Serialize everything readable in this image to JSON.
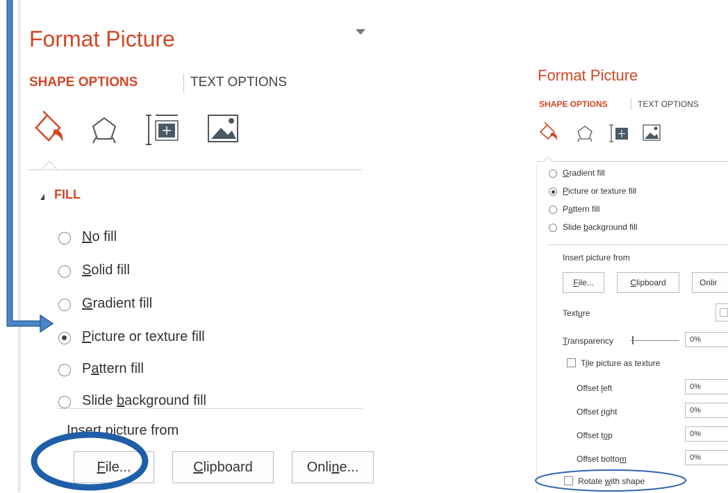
{
  "large_panel": {
    "title": "Format Picture",
    "tabs": [
      "SHAPE OPTIONS",
      "TEXT OPTIONS"
    ],
    "icons": [
      "fill-line-icon",
      "effects-pentagon-icon",
      "size-properties-icon",
      "picture-icon"
    ],
    "section": "FILL",
    "fill_options": [
      {
        "pre": "",
        "key": "N",
        "post": "o fill",
        "checked": false
      },
      {
        "pre": "",
        "key": "S",
        "post": "olid fill",
        "checked": false
      },
      {
        "pre": "",
        "key": "G",
        "post": "radient fill",
        "checked": false
      },
      {
        "pre": "",
        "key": "P",
        "post": "icture or texture fill",
        "checked": true
      },
      {
        "pre": "P",
        "key": "a",
        "post": "ttern fill",
        "checked": false
      },
      {
        "pre": "Slide ",
        "key": "b",
        "post": "ackground fill",
        "checked": false
      }
    ],
    "insert_label": "Insert picture from",
    "buttons": {
      "file": {
        "pre": "",
        "key": "F",
        "post": "ile..."
      },
      "clipboard": {
        "pre": "",
        "key": "C",
        "post": "lipboard"
      },
      "online": {
        "pre": "Onli",
        "key": "n",
        "post": "e..."
      }
    }
  },
  "small_panel": {
    "title": "Format Picture",
    "tabs": [
      "SHAPE OPTIONS",
      "TEXT OPTIONS"
    ],
    "fill_options": [
      {
        "pre": "",
        "key": "G",
        "post": "radient fill",
        "checked": false
      },
      {
        "pre": "",
        "key": "P",
        "post": "icture or texture fill",
        "checked": true
      },
      {
        "pre": "P",
        "key": "a",
        "post": "ttern fill",
        "checked": false
      },
      {
        "pre": "Slide ",
        "key": "b",
        "post": "ackground fill",
        "checked": false
      }
    ],
    "insert_label": "Insert picture from",
    "buttons": {
      "file": {
        "pre": "",
        "key": "F",
        "post": "ile..."
      },
      "clipboard": {
        "pre": "",
        "key": "C",
        "post": "lipboard"
      },
      "online": "Onlir"
    },
    "texture": {
      "pre": "Text",
      "key": "u",
      "post": "re"
    },
    "transparency": {
      "pre": "",
      "key": "T",
      "post": "ransparency",
      "value": "0%"
    },
    "tile_checkbox": {
      "pre": "T",
      "key": "i",
      "post": "le picture as texture"
    },
    "offsets": [
      {
        "pre": "Offset ",
        "key": "l",
        "post": "eft",
        "value": "0%"
      },
      {
        "pre": "Offset ",
        "key": "r",
        "post": "ight",
        "value": "0%"
      },
      {
        "pre": "Offset t",
        "key": "o",
        "post": "p",
        "value": "0%"
      },
      {
        "pre": "Offset botto",
        "key": "m",
        "post": "",
        "value": "0%"
      }
    ],
    "rotate_checkbox": {
      "pre": "Rotate ",
      "key": "w",
      "post": "ith shape"
    }
  },
  "colors": {
    "accent": "#d24726",
    "callout": "#2e74b5"
  }
}
